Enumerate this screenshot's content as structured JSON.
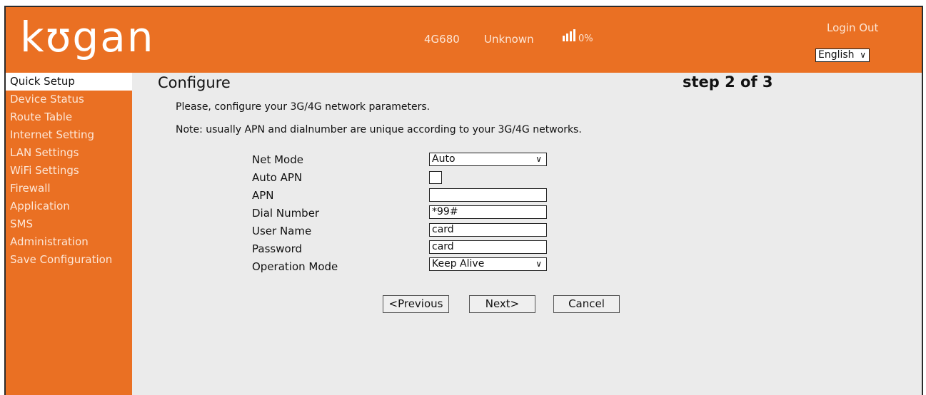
{
  "header": {
    "logo": "kʊgan",
    "model": "4G680",
    "network": "Unknown",
    "signal_percent": "0%",
    "signal_bars": 4,
    "login_label": "Login Out",
    "language": "English"
  },
  "sidebar": {
    "items": [
      {
        "label": "Quick Setup",
        "active": true
      },
      {
        "label": "Device Status"
      },
      {
        "label": "Route Table"
      },
      {
        "label": "Internet Setting"
      },
      {
        "label": "LAN Settings"
      },
      {
        "label": "WiFi Settings"
      },
      {
        "label": "Firewall"
      },
      {
        "label": "Application"
      },
      {
        "label": "SMS"
      },
      {
        "label": "Administration"
      },
      {
        "label": "Save Configuration"
      }
    ]
  },
  "main": {
    "title": "Configure",
    "step": "step 2 of 3",
    "desc1": "Please, configure your 3G/4G network parameters.",
    "desc2": "Note: usually APN and dialnumber are unique according to your 3G/4G networks."
  },
  "form": {
    "net_mode": {
      "label": "Net Mode",
      "value": "Auto"
    },
    "auto_apn": {
      "label": "Auto APN",
      "checked": false
    },
    "apn": {
      "label": "APN",
      "value": ""
    },
    "dial_number": {
      "label": "Dial Number",
      "value": "*99#"
    },
    "user_name": {
      "label": "User Name",
      "value": "card"
    },
    "password": {
      "label": "Password",
      "value": "card"
    },
    "operation_mode": {
      "label": "Operation Mode",
      "value": "Keep Alive"
    }
  },
  "buttons": {
    "previous": "<Previous",
    "next": "Next>",
    "cancel": "Cancel"
  },
  "colors": {
    "brand_orange": "#ea7023",
    "content_bg": "#ebebeb"
  }
}
